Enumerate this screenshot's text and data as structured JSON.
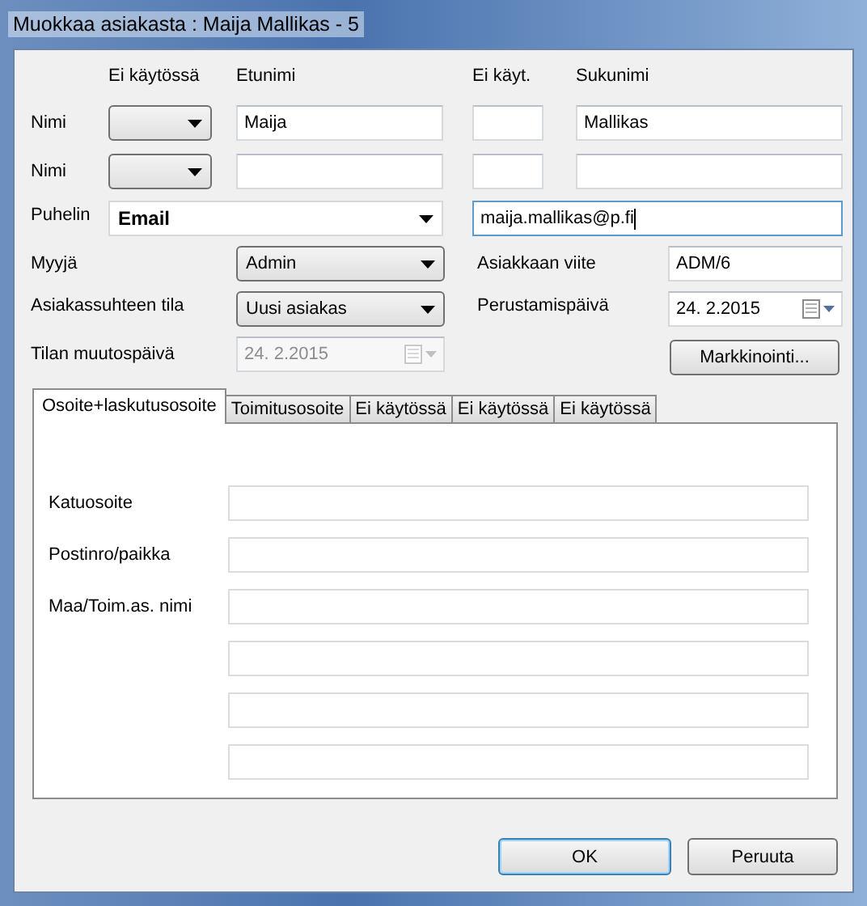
{
  "window": {
    "title": "Muokkaa asiakasta : Maija Mallikas - 5"
  },
  "name_headers": [
    "Ei käytössä",
    "Etunimi",
    "Ei käyt.",
    "Sukunimi"
  ],
  "name_rows": [
    {
      "label": "Nimi",
      "first_name": "Maija",
      "last_name": "Mallikas"
    },
    {
      "label": "Nimi"
    }
  ],
  "contact": {
    "label": "Puhelin",
    "type": "Email",
    "value": "maija.mallikas@p.fi",
    "focused": true
  },
  "details": [
    {
      "label": "Myyjä",
      "value": "Admin",
      "kind": "combo",
      "side": {
        "label": "Asiakkaan viite",
        "value": "ADM/6",
        "kind": "text"
      }
    },
    {
      "label": "Asiakassuhteen tila",
      "value": "Uusi asiakas",
      "kind": "combo",
      "side": {
        "label": "Perustamispäivä",
        "value": "24.  2.2015",
        "kind": "date"
      }
    },
    {
      "label": "Tilan muutospäivä",
      "value": "24.  2.2015",
      "kind": "date",
      "disabled": true,
      "side_button": "Markkinointi..."
    }
  ],
  "tabs": [
    {
      "label": "Osoite+laskutusosoite",
      "selected": true
    },
    {
      "label": "Toimitusosoite",
      "selected": false
    },
    {
      "label": "Ei käytössä",
      "selected": false
    },
    {
      "label": "Ei käytössä",
      "selected": false
    },
    {
      "label": "Ei käytössä",
      "selected": false
    }
  ],
  "address_lines": [
    {
      "kind": "labeled",
      "label": "Katuosoite"
    },
    {
      "kind": "labeled",
      "label": "Postinro/paikka"
    },
    {
      "kind": "labeled",
      "label": "Maa/Toim.as. nimi"
    },
    {
      "kind": "blank"
    },
    {
      "kind": "blank"
    },
    {
      "kind": "blank"
    }
  ],
  "buttons": [
    {
      "label": "OK",
      "default": true
    },
    {
      "label": "Peruuta",
      "default": false
    }
  ]
}
